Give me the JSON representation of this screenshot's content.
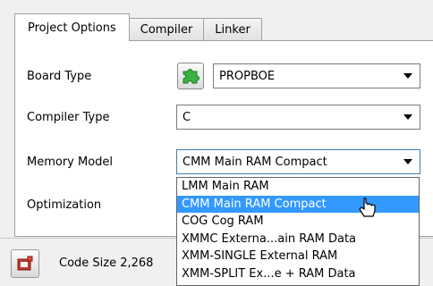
{
  "tabs": [
    {
      "label": "Project Options",
      "active": true
    },
    {
      "label": "Compiler",
      "active": false
    },
    {
      "label": "Linker",
      "active": false
    }
  ],
  "fields": {
    "board_type": {
      "label": "Board Type",
      "value": "PROPBOE"
    },
    "compiler_type": {
      "label": "Compiler Type",
      "value": "C"
    },
    "memory_model": {
      "label": "Memory Model",
      "value": "CMM Main RAM Compact"
    },
    "optimization": {
      "label": "Optimization"
    }
  },
  "memory_model_options": [
    "LMM Main RAM",
    "CMM Main RAM Compact",
    "COG Cog RAM",
    "XMMC Externa...ain RAM Data",
    "XMM-SINGLE External RAM",
    "XMM-SPLIT Ex...e + RAM Data"
  ],
  "memory_model_selected_index": 1,
  "status": {
    "code_size_text": "Code Size 2,268"
  },
  "icons": {
    "board_button": "green-puzzle-icon",
    "status_button": "red-board-icon",
    "cursor": "mouse-pointer-icon"
  },
  "colors": {
    "selection": "#3399ff",
    "puzzle_green": "#3cb043"
  }
}
